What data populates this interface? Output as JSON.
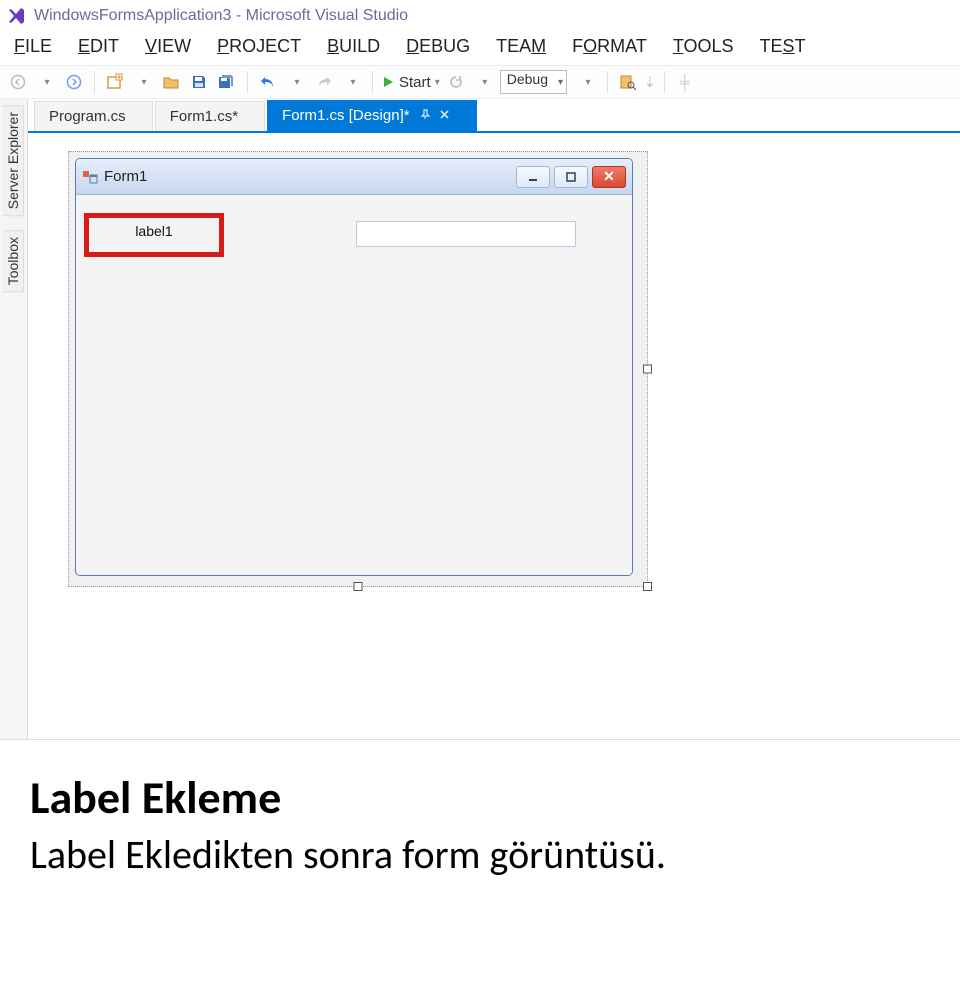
{
  "title": "WindowsFormsApplication3 - Microsoft Visual Studio",
  "menu": {
    "file": "FILE",
    "edit": "EDIT",
    "view": "VIEW",
    "project": "PROJECT",
    "build": "BUILD",
    "debug": "DEBUG",
    "team": "TEAM",
    "format": "FORMAT",
    "tools": "TOOLS",
    "test": "TEST"
  },
  "toolbar": {
    "start_label": "Start",
    "config_value": "Debug"
  },
  "sidetabs": {
    "server_explorer": "Server Explorer",
    "toolbox": "Toolbox"
  },
  "doctabs": {
    "tab1": "Program.cs",
    "tab2": "Form1.cs*",
    "tab3": "Form1.cs [Design]*"
  },
  "form": {
    "title": "Form1",
    "label1": "label1"
  },
  "caption": {
    "heading": "Label Ekleme",
    "text": "Label Ekledikten sonra form görüntüsü."
  }
}
